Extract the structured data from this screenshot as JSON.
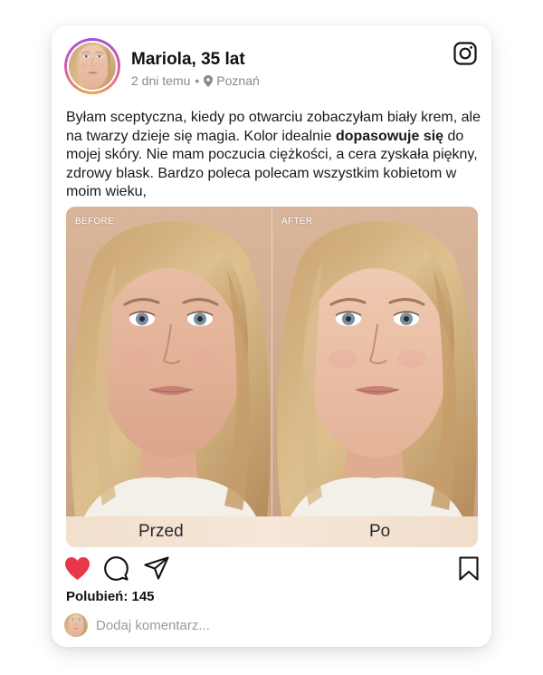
{
  "post": {
    "author": "Mariola, 35 lat",
    "time": "2 dni temu",
    "separator": "•",
    "location": "Poznań",
    "text_before_bold": "Byłam sceptyczna, kiedy po otwarciu zobaczyłam biały krem, ale na twarzy dzieje się magia. Kolor idealnie ",
    "text_bold": "dopasowuje się",
    "text_after_bold": " do mojej skóry. Nie mam poczucia ciężkości, a cera zyskała piękny, zdrowy blask. Bardzo poleca polecam wszystkim kobietom w moim wieku,"
  },
  "photo": {
    "before_label": "BEFORE",
    "after_label": "AFTER",
    "caption_left": "Przed",
    "caption_right": "Po"
  },
  "actions": {
    "like_icon": "heart-icon",
    "comment_icon": "comment-icon",
    "share_icon": "send-icon",
    "save_icon": "bookmark-icon",
    "liked_color": "#e8364a"
  },
  "likes": {
    "text": "Polubień: 145"
  },
  "comment": {
    "placeholder": "Dodaj komentarz..."
  },
  "brand": {
    "icon": "instagram-icon"
  }
}
